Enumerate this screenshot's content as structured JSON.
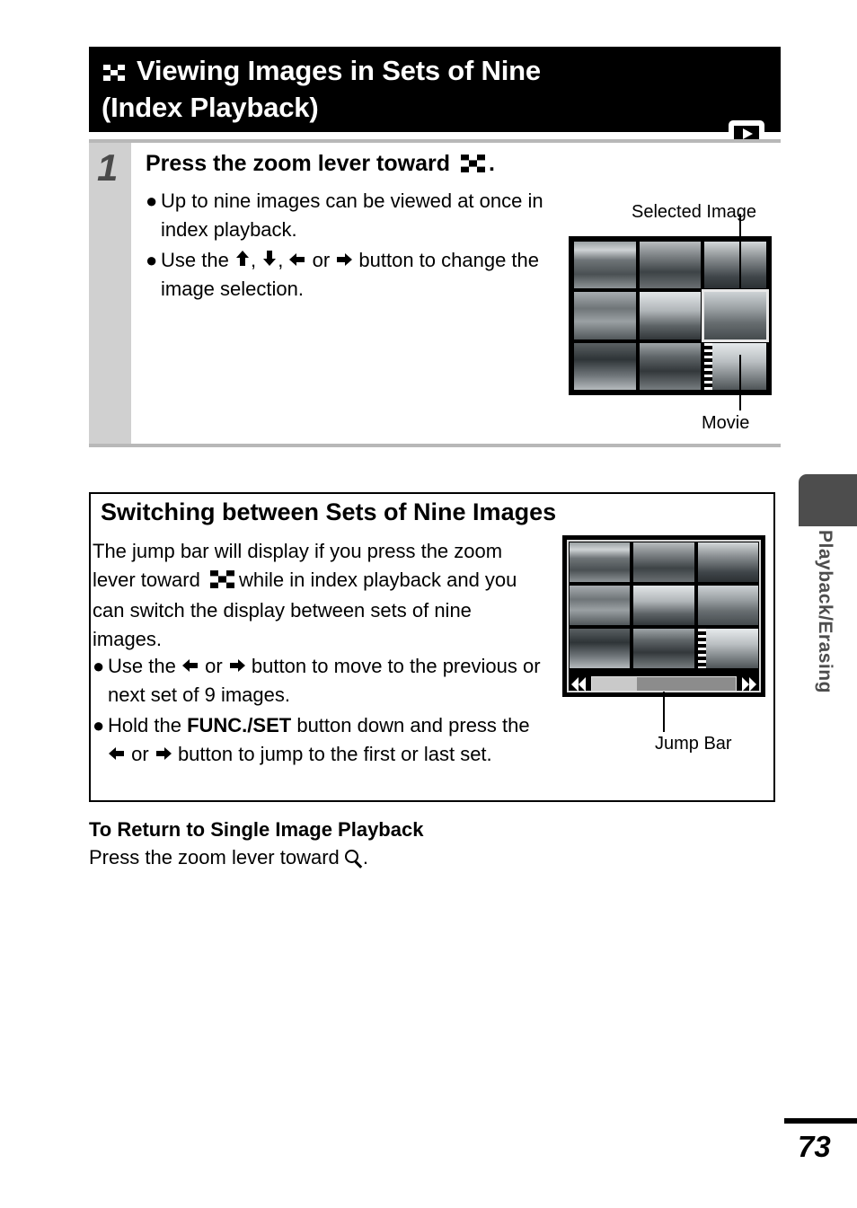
{
  "header": {
    "icon": "index-checkerboard-icon",
    "title_line1": "Viewing Images in Sets of Nine",
    "title_line2": "(Index Playback)",
    "badge_icon": "playback-mode-icon",
    "bg_color": "#000000",
    "text_color": "#ffffff"
  },
  "step1": {
    "number": "1",
    "heading_before_icon": "Press the zoom lever toward",
    "heading_icon": "index-checkerboard-icon",
    "heading_after_icon": ".",
    "bullet_marker": "●",
    "bullets": [
      {
        "text": "Up to nine images can be viewed at once in index playback."
      },
      {
        "prefix": "Use the",
        "icons": [
          "up-arrow-icon",
          "down-arrow-icon",
          "left-arrow-icon",
          "right-arrow-icon"
        ],
        "separator_1": ",",
        "separator_2": ",",
        "separator_3": "or",
        "suffix": "button to change the image selection."
      }
    ],
    "screen": {
      "name": "index-playback-screen",
      "selected_cell_index": 5,
      "movie_cell_index": 8,
      "callouts": [
        {
          "label": "Selected Image",
          "target": "selected-image"
        },
        {
          "label": "Movie",
          "target": "movie-clip"
        }
      ]
    }
  },
  "switching": {
    "heading": "Switching between Sets of Nine Images",
    "paragraph_part1": "The jump bar will display if you press the zoom lever toward",
    "paragraph_icon": "index-checkerboard-icon",
    "paragraph_part2": "while in index playback and you can switch the display between sets of nine images.",
    "bullet_marker": "●",
    "bullets": [
      {
        "prefix": "Use the",
        "icon_left": "left-arrow-icon",
        "or": "or",
        "icon_right": "right-arrow-icon",
        "suffix": "button to move to the previous or next set of 9 images."
      },
      {
        "prefix": "Hold the",
        "bold_term": "FUNC./SET",
        "mid": "button down and press the",
        "icon_left": "left-arrow-icon",
        "or": "or",
        "icon_right": "right-arrow-icon",
        "suffix": "button to jump to the first or last set."
      }
    ],
    "screen": {
      "name": "index-playback-jumpbar-screen",
      "jumpbar": {
        "left_icon": "double-left-arrow-icon",
        "right_icon": "double-right-arrow-icon",
        "thumb_position_percent": 31
      },
      "callouts": [
        {
          "label": "Jump Bar",
          "target": "jump-bar"
        }
      ]
    }
  },
  "return_section": {
    "heading": "To Return to Single Image Playback",
    "text_before_icon": "Press the zoom lever toward",
    "icon": "magnifier-icon",
    "text_after_icon": "."
  },
  "side_tab": {
    "label": "Playback/Erasing",
    "color": "#4d4d4d"
  },
  "footer": {
    "page_number": "73"
  }
}
